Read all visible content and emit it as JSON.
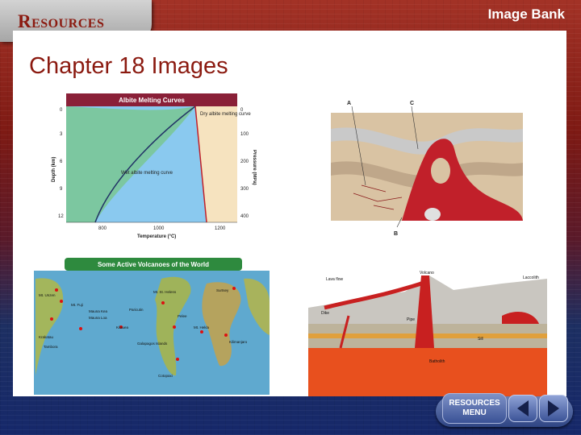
{
  "header": {
    "section_label": "Resources",
    "right_label": "Image Bank"
  },
  "main": {
    "chapter_title": "Chapter 18 Images",
    "melting_chart": {
      "title": "Albite Melting Curves",
      "dry_curve_label": "Dry albite melting curve",
      "wet_curve_label": "Wet albite melting curve",
      "x_axis_label": "Temperature (°C)",
      "left_axis_label": "Depth (km)",
      "right_axis_label": "Pressure (MPa)",
      "x_ticks": [
        "800",
        "1000",
        "1200"
      ],
      "depth_ticks": [
        "0",
        "3",
        "6",
        "9",
        "12"
      ],
      "pressure_ticks": [
        "0",
        "100",
        "200",
        "300",
        "400"
      ]
    },
    "intrusion_diagram": {
      "labels": [
        "A",
        "C",
        "B"
      ]
    },
    "volcano_map": {
      "title": "Some Active Volcanoes of the World",
      "places": [
        "Mt. Unzen",
        "Mt. Fuji",
        "Mauna Kea",
        "Mauna Loa",
        "Paricutin",
        "Kilauea",
        "Mt. St. Helens",
        "Surtsey",
        "Pelee",
        "Galapagos Islands",
        "Krakatau",
        "Tambora",
        "Kilimanjaro",
        "Mt. Hekla",
        "Cotopaxi"
      ]
    },
    "igneous_diagram": {
      "labels": [
        "Volcano",
        "Lava flow",
        "Laccolith",
        "Dike",
        "Pipe",
        "Sill",
        "Batholith"
      ]
    }
  },
  "nav": {
    "menu_label_1": "RESOURCES",
    "menu_label_2": "MENU"
  }
}
